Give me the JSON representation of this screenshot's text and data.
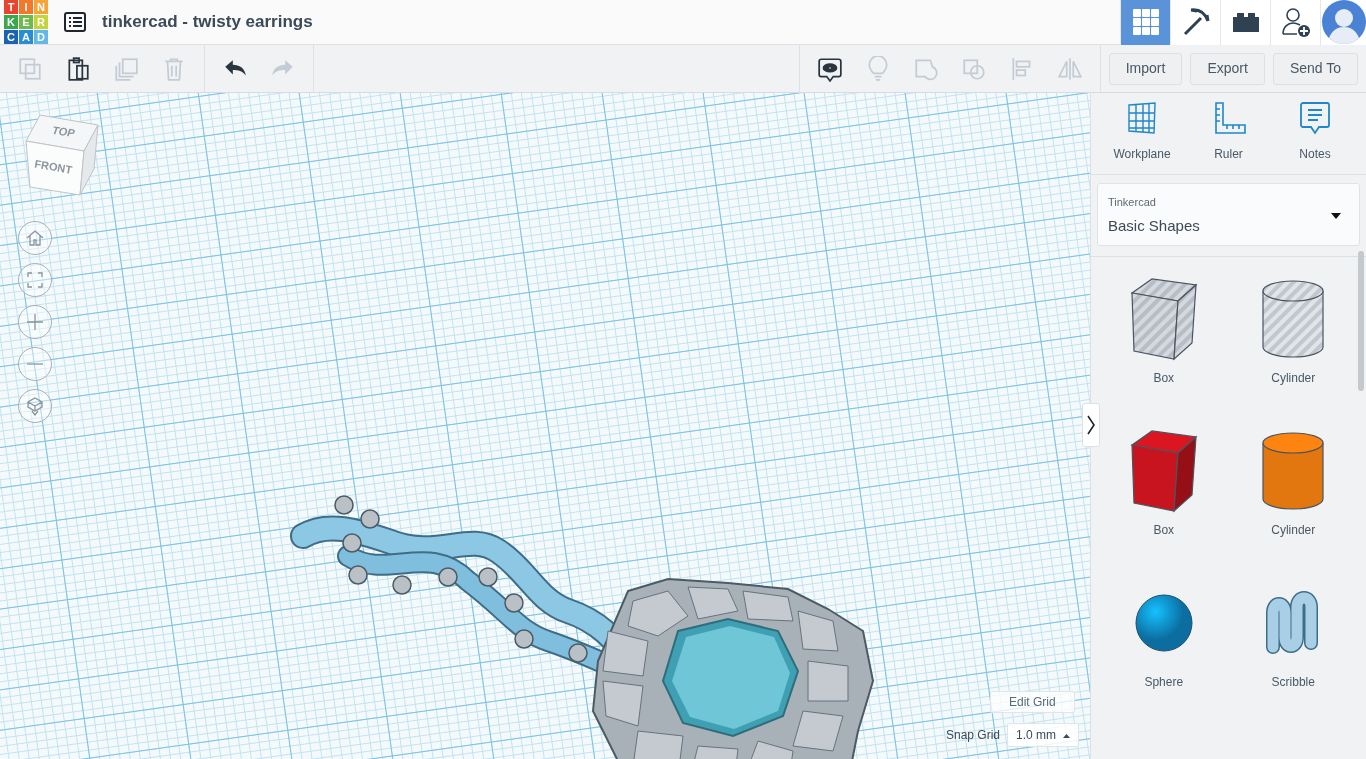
{
  "header": {
    "logo": [
      {
        "char": "T",
        "color": "#e9442d"
      },
      {
        "char": "I",
        "color": "#f2782b"
      },
      {
        "char": "N",
        "color": "#f6a33a"
      },
      {
        "char": "K",
        "color": "#3aa84a"
      },
      {
        "char": "E",
        "color": "#6cba48"
      },
      {
        "char": "R",
        "color": "#c4d43c"
      },
      {
        "char": "C",
        "color": "#1b63b1"
      },
      {
        "char": "A",
        "color": "#2b8bd5"
      },
      {
        "char": "D",
        "color": "#63b8e6"
      }
    ],
    "title": "tinkercad - twisty earrings",
    "nav": [
      {
        "kind": "grid",
        "selected": true
      },
      {
        "kind": "pickaxe",
        "selected": false
      },
      {
        "kind": "brick",
        "selected": false
      },
      {
        "kind": "add-user",
        "selected": false
      }
    ]
  },
  "toolbar": {
    "edit_tools": [
      {
        "kind": "copy",
        "disabled": true
      },
      {
        "kind": "paste",
        "disabled": false
      },
      {
        "kind": "duplicate",
        "disabled": true
      },
      {
        "kind": "delete",
        "disabled": true
      }
    ],
    "history_tools": [
      {
        "kind": "undo",
        "disabled": false
      },
      {
        "kind": "redo",
        "disabled": true
      }
    ],
    "view_tools": [
      {
        "kind": "notes",
        "disabled": false
      },
      {
        "kind": "bulb",
        "disabled": true
      },
      {
        "kind": "group",
        "disabled": true
      },
      {
        "kind": "ungroup",
        "disabled": true
      },
      {
        "kind": "align",
        "disabled": true
      },
      {
        "kind": "mirror",
        "disabled": true
      }
    ],
    "buttons": [
      "Import",
      "Export",
      "Send To"
    ]
  },
  "viewcube": {
    "top": "TOP",
    "front": "FRONT"
  },
  "view_controls": [
    {
      "kind": "home"
    },
    {
      "kind": "fit"
    },
    {
      "kind": "zoom-in"
    },
    {
      "kind": "zoom-out"
    },
    {
      "kind": "perspective"
    }
  ],
  "grid_controls": {
    "edit_grid": "Edit Grid",
    "snap_label": "Snap Grid",
    "snap_value": "1.0 mm"
  },
  "panel": {
    "tools": [
      {
        "kind": "workplane",
        "label": "Workplane"
      },
      {
        "kind": "ruler",
        "label": "Ruler"
      },
      {
        "kind": "notes",
        "label": "Notes"
      }
    ],
    "library": {
      "label": "Tinkercad",
      "value": "Basic Shapes"
    },
    "shapes": [
      {
        "kind": "box",
        "label": "Box",
        "color": "#b8bdc4",
        "striped": true
      },
      {
        "kind": "cylinder",
        "label": "Cylinder",
        "color": "#c3c7cc",
        "striped": true
      },
      {
        "kind": "box",
        "label": "Box",
        "color": "#c8141e",
        "striped": false
      },
      {
        "kind": "cylinder",
        "label": "Cylinder",
        "color": "#e2760f",
        "striped": false
      },
      {
        "kind": "sphere",
        "label": "Sphere",
        "color": "#0f8ac8",
        "striped": false
      },
      {
        "kind": "scribble",
        "label": "Scribble",
        "color": "#a9cfe6",
        "striped": false
      }
    ]
  }
}
